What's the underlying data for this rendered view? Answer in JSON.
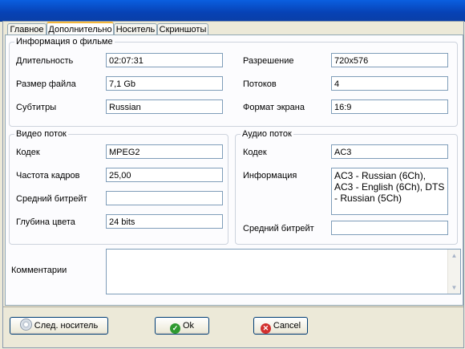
{
  "tabs": [
    "Главное",
    "Дополнительно",
    "Носитель",
    "Скриншоты"
  ],
  "movie_info": {
    "legend": "Информация о фильме",
    "duration_label": "Длительность",
    "duration_value": "02:07:31",
    "filesize_label": "Размер файла",
    "filesize_value": "7,1 Gb",
    "subtitles_label": "Субтитры",
    "subtitles_value": "Russian",
    "resolution_label": "Разрешение",
    "resolution_value": "720x576",
    "streams_label": "Потоков",
    "streams_value": "4",
    "aspect_label": "Формат экрана",
    "aspect_value": "16:9"
  },
  "video": {
    "legend": "Видео поток",
    "codec_label": "Кодек",
    "codec_value": "MPEG2",
    "fps_label": "Частота кадров",
    "fps_value": "25,00",
    "bitrate_label": "Средний битрейт",
    "bitrate_value": "",
    "depth_label": "Глубина цвета",
    "depth_value": "24 bits"
  },
  "audio": {
    "legend": "Аудио поток",
    "codec_label": "Кодек",
    "codec_value": "AC3",
    "info_label": "Информация",
    "info_value": "AC3 - Russian (6Ch), AC3 - English (6Ch), DTS - Russian (5Ch)",
    "bitrate_label": "Средний битрейт",
    "bitrate_value": ""
  },
  "comment_label": "Комментарии",
  "comment_value": "",
  "buttons": {
    "next_media": "След. носитель",
    "ok": "Ok",
    "cancel": "Cancel"
  },
  "colors": {
    "title_bar": "#0A5FE0",
    "ok_icon": "#2f9a2f",
    "cancel_icon": "#d2302e",
    "active_tab_accent": "#f3b63c"
  }
}
